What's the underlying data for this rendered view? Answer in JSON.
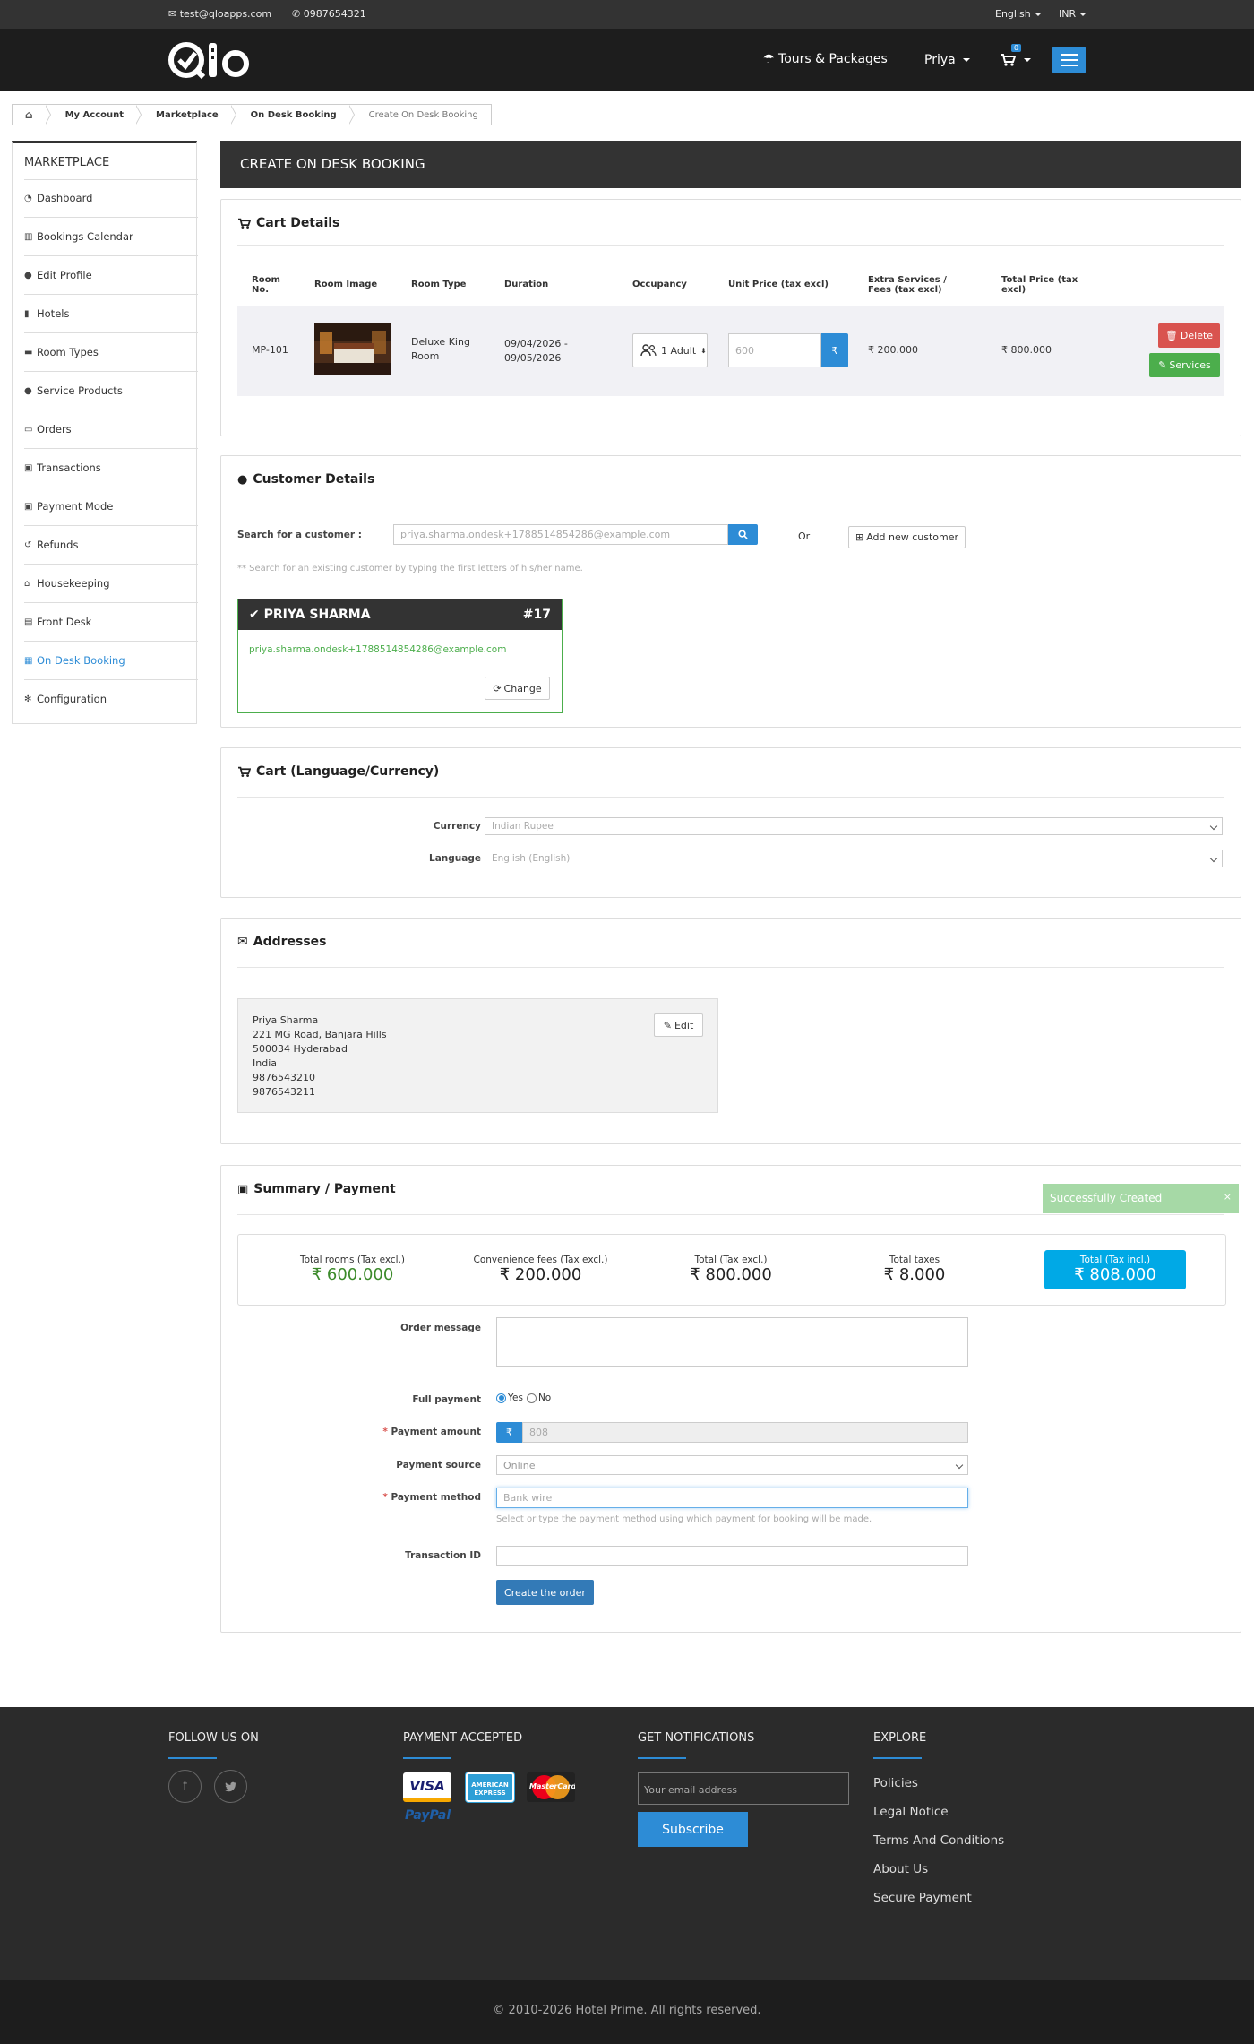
{
  "topbar": {
    "email": "test@qloapps.com",
    "phone": "0987654321",
    "language": "English",
    "currency": "INR"
  },
  "header": {
    "logo_text": "Qlo",
    "tours_label": "Tours & Packages",
    "user_label": "Priya",
    "cart_count": "0"
  },
  "breadcrumb": [
    "My Account",
    "Marketplace",
    "On Desk Booking",
    "Create On Desk Booking"
  ],
  "sidebar": {
    "title": "MARKETPLACE",
    "items": [
      {
        "label": "Dashboard",
        "icon": "dashboard-icon"
      },
      {
        "label": "Bookings Calendar",
        "icon": "bar-chart-icon"
      },
      {
        "label": "Edit Profile",
        "icon": "user-icon"
      },
      {
        "label": "Hotels",
        "icon": "building-icon"
      },
      {
        "label": "Room Types",
        "icon": "bed-icon"
      },
      {
        "label": "Service Products",
        "icon": "user-plus-icon"
      },
      {
        "label": "Orders",
        "icon": "credit-card-icon"
      },
      {
        "label": "Transactions",
        "icon": "money-icon"
      },
      {
        "label": "Payment Mode",
        "icon": "money-icon"
      },
      {
        "label": "Refunds",
        "icon": "undo-icon"
      },
      {
        "label": "Housekeeping",
        "icon": "home-icon"
      },
      {
        "label": "Front Desk",
        "icon": "desk-icon"
      },
      {
        "label": "On Desk Booking",
        "icon": "calendar-icon"
      },
      {
        "label": "Configuration",
        "icon": "gear-icon"
      }
    ],
    "active": "On Desk Booking"
  },
  "page_title": "CREATE ON DESK BOOKING",
  "cart": {
    "title": "Cart Details",
    "headers": {
      "room_no": "Room No.",
      "room_image": "Room Image",
      "room_type": "Room Type",
      "duration": "Duration",
      "occupancy": "Occupancy",
      "unit_price": "Unit Price (tax excl)",
      "extra": "Extra Services / Fees (tax excl)",
      "total": "Total Price (tax excl)"
    },
    "row": {
      "room_no": "MP-101",
      "room_type": "Deluxe King Room",
      "duration": "09/04/2026 - 09/05/2026",
      "occupancy": "1 Adult",
      "unit_price_placeholder": "600",
      "currency_symbol": "₹",
      "extra": "₹ 200.000",
      "total": "₹ 800.000"
    },
    "delete_label": "Delete",
    "services_label": "Services"
  },
  "customer": {
    "title": "Customer Details",
    "search_label": "Search for a customer :",
    "search_value": "priya.sharma.ondesk+1788514854286@example.com",
    "or_label": "Or",
    "add_label": "Add new customer",
    "hint": "** Search for an existing customer by typing the first letters of his/her name.",
    "name": "PRIYA SHARMA",
    "id": "#17",
    "email": "priya.sharma.ondesk+1788514854286@example.com",
    "change_label": "Change"
  },
  "cart_lang": {
    "title": "Cart (Language/Currency)",
    "currency_label": "Currency",
    "currency_value": "Indian Rupee",
    "language_label": "Language",
    "language_value": "English (English)"
  },
  "addresses": {
    "title": "Addresses",
    "lines": [
      "Priya Sharma",
      "221 MG Road, Banjara Hills",
      "500034 Hyderabad",
      "India",
      "9876543210",
      "9876543211"
    ],
    "edit_label": "Edit"
  },
  "summary": {
    "title": "Summary / Payment",
    "alert": "Successfully Created",
    "totals": [
      {
        "label": "Total rooms (Tax excl.)",
        "value": "₹ 600.000"
      },
      {
        "label": "Convenience fees (Tax excl.)",
        "value": "₹ 200.000"
      },
      {
        "label": "Total (Tax excl.)",
        "value": "₹ 800.000"
      },
      {
        "label": "Total taxes",
        "value": "₹ 8.000"
      },
      {
        "label": "Total (Tax incl.)",
        "value": "₹ 808.000"
      }
    ],
    "order_message_label": "Order message",
    "full_payment_label": "Full payment",
    "yes_label": "Yes",
    "no_label": "No",
    "payment_amount_label": "Payment amount",
    "payment_amount_value": "808",
    "payment_source_label": "Payment source",
    "payment_source_value": "Online",
    "payment_method_label": "Payment method",
    "payment_method_value": "Bank wire",
    "payment_method_hint": "Select or type the payment method using which payment for booking will be made.",
    "transaction_label": "Transaction ID",
    "create_label": "Create the order",
    "required_mark": "*"
  },
  "footer": {
    "follow": "FOLLOW US ON",
    "payment": "PAYMENT ACCEPTED",
    "notifications": "GET NOTIFICATIONS",
    "explore": "EXPLORE",
    "email_placeholder": "Your email address",
    "subscribe": "Subscribe",
    "links": [
      "Policies",
      "Legal Notice",
      "Terms And Conditions",
      "About Us",
      "Secure Payment"
    ],
    "cards": [
      "VISA",
      "AMERICAN EXPRESS",
      "MasterCard",
      "PayPal"
    ],
    "copyright": "© 2010-2026 Hotel Prime.  All rights reserved."
  },
  "colors": {
    "accent": "#2d8cd6",
    "success": "#4cae4c",
    "danger": "#d9534f",
    "dark": "#333333",
    "total_highlight": "#00a9e6"
  }
}
